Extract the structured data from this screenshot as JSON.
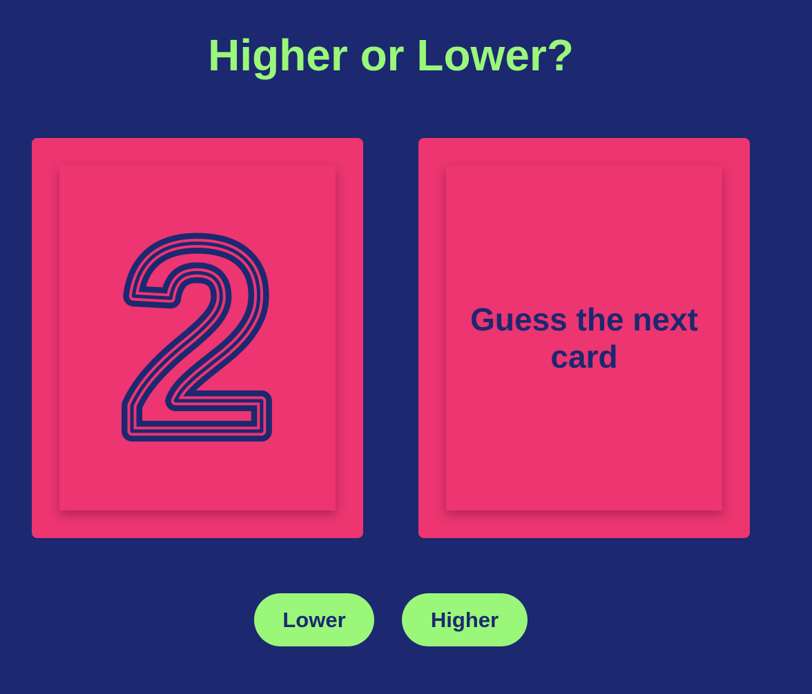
{
  "title": "Higher or Lower?",
  "current_card": {
    "value": "2"
  },
  "next_card": {
    "prompt": "Guess the next card"
  },
  "buttons": {
    "lower": "Lower",
    "higher": "Higher"
  },
  "colors": {
    "background": "#1c2870",
    "card": "#ec3571",
    "accent": "#9af77a"
  }
}
